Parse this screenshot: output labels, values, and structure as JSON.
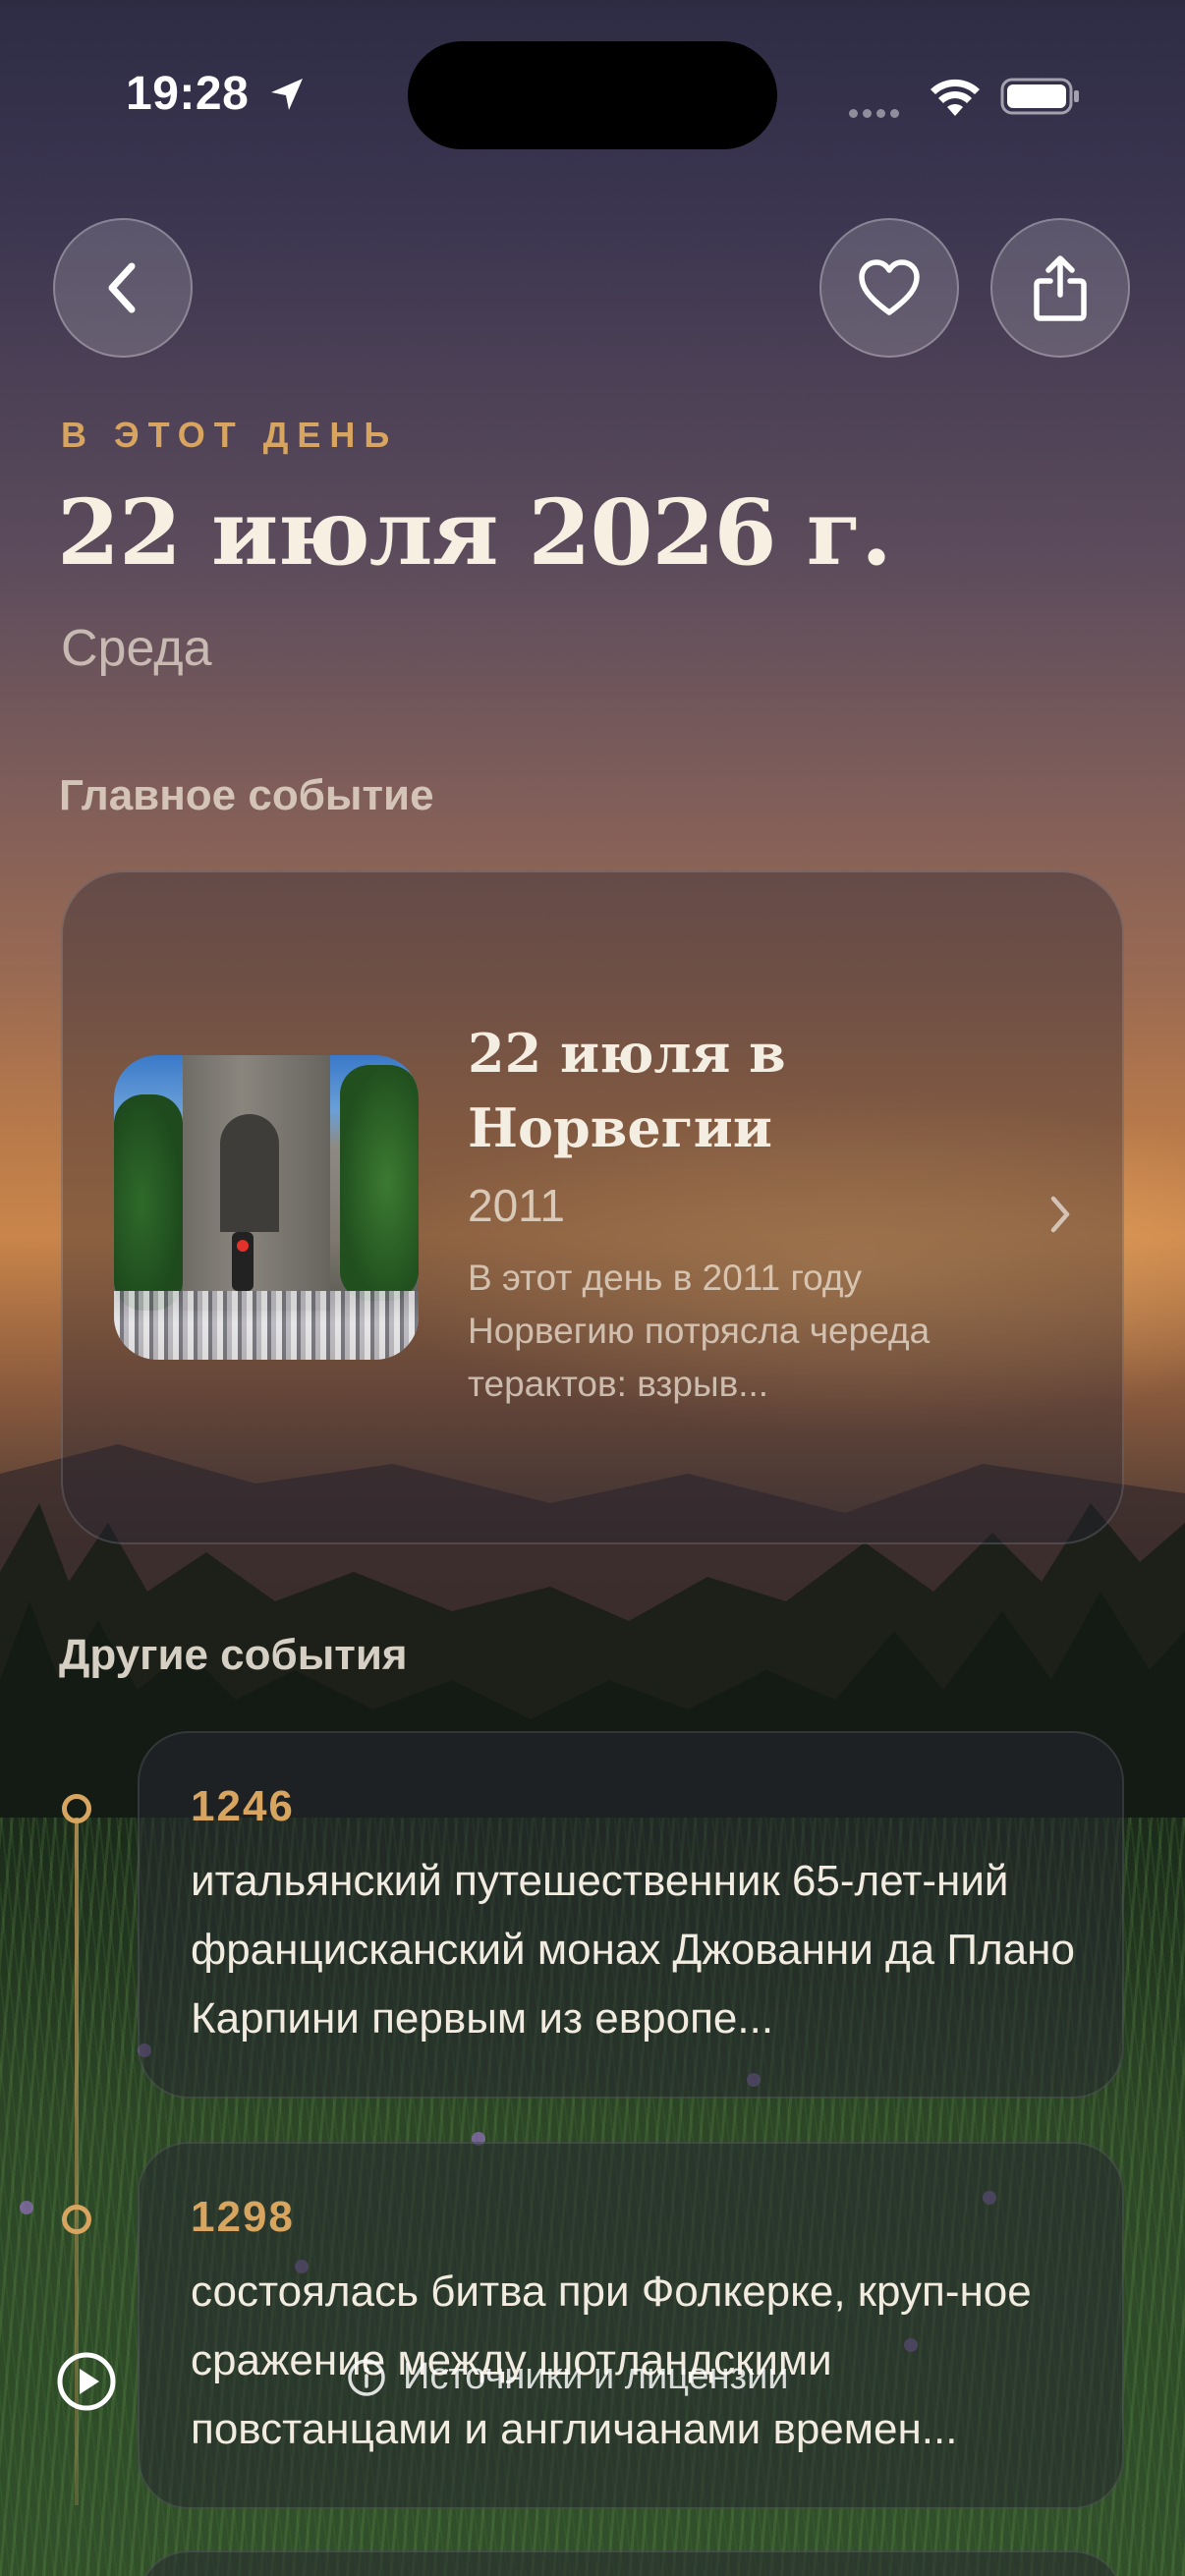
{
  "status_bar": {
    "time": "19:28"
  },
  "header": {
    "eyebrow": "В ЭТОТ ДЕНЬ",
    "date": "22 июля 2026 г.",
    "weekday": "Среда"
  },
  "sections": {
    "main": "Главное событие",
    "other": "Другие события"
  },
  "featured": {
    "title": "22 июля в Норвегии",
    "year": "2011",
    "description": "В этот день в 2011 году Норвегию потрясла череда терактов: взрыв..."
  },
  "events": [
    {
      "year": "1246",
      "text": "итальянский путешественник 65-лет-ний францисканский монах Джованни да Плано Карпини первым из европе..."
    },
    {
      "year": "1298",
      "text": "состоялась битва при Фолкерке, круп-ное сражение между шотландскими повстанцами и англичанами времен..."
    }
  ],
  "footer": {
    "sources_label": "Источники и лицензии"
  },
  "icons": {
    "back": "chevron-left-icon",
    "favorite": "heart-icon",
    "share": "share-icon",
    "play": "play-icon",
    "info": "info-icon"
  },
  "colors": {
    "accent_gold": "#d8a560",
    "title_text": "#f6efe2"
  }
}
